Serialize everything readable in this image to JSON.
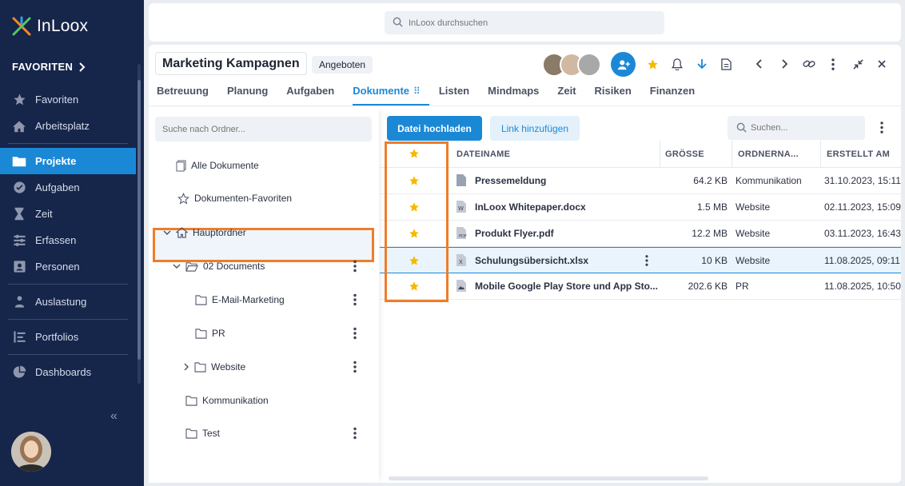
{
  "app": {
    "logo_text": "InLoox"
  },
  "sidebar": {
    "favorites_label": "FAVORITEN",
    "items": [
      {
        "label": "Favoriten"
      },
      {
        "label": "Arbeitsplatz"
      },
      {
        "label": "Projekte"
      },
      {
        "label": "Aufgaben"
      },
      {
        "label": "Zeit"
      },
      {
        "label": "Erfassen"
      },
      {
        "label": "Personen"
      },
      {
        "label": "Auslastung"
      },
      {
        "label": "Portfolios"
      },
      {
        "label": "Dashboards"
      }
    ],
    "collapse_glyph": "«"
  },
  "search": {
    "placeholder": "InLoox durchsuchen"
  },
  "project": {
    "title": "Marketing Kampagnen",
    "status": "Angeboten"
  },
  "tabs": [
    {
      "label": "Betreuung"
    },
    {
      "label": "Planung"
    },
    {
      "label": "Aufgaben"
    },
    {
      "label": "Dokumente"
    },
    {
      "label": "Listen"
    },
    {
      "label": "Mindmaps"
    },
    {
      "label": "Zeit"
    },
    {
      "label": "Risiken"
    },
    {
      "label": "Finanzen"
    }
  ],
  "folders": {
    "search_placeholder": "Suche nach Ordner...",
    "all_documents": "Alle Dokumente",
    "favorites": "Dokumenten-Favoriten",
    "root": "Hauptordner",
    "children": [
      {
        "label": "02 Documents"
      },
      {
        "label": "E-Mail-Marketing"
      },
      {
        "label": "PR"
      },
      {
        "label": "Website"
      },
      {
        "label": "Kommunikation"
      },
      {
        "label": "Test"
      }
    ]
  },
  "toolbar": {
    "upload_label": "Datei hochladen",
    "add_link_label": "Link hinzufügen",
    "search_placeholder": "Suchen..."
  },
  "table": {
    "headers": {
      "name": "DATEINAME",
      "size": "GRÖSSE",
      "folder": "ORDNERNA...",
      "created": "ERSTELLT AM"
    },
    "rows": [
      {
        "name": "Pressemeldung",
        "size": "64.2 KB",
        "folder": "Kommunikation",
        "created": "31.10.2023, 15:11",
        "icon": "file-icon"
      },
      {
        "name": "InLoox Whitepaper.docx",
        "size": "1.5 MB",
        "folder": "Website",
        "created": "02.11.2023, 15:09",
        "icon": "word-file-icon"
      },
      {
        "name": "Produkt Flyer.pdf",
        "size": "12.2 MB",
        "folder": "Website",
        "created": "03.11.2023, 16:43",
        "icon": "pdf-file-icon"
      },
      {
        "name": "Schulungsübersicht.xlsx",
        "size": "10 KB",
        "folder": "Website",
        "created": "11.08.2025, 09:11",
        "icon": "excel-file-icon"
      },
      {
        "name": "Mobile Google Play Store und App Sto...",
        "size": "202.6 KB",
        "folder": "PR",
        "created": "11.08.2025, 10:50",
        "icon": "image-file-icon"
      }
    ]
  },
  "colors": {
    "accent": "#1b88d6",
    "sidebar_bg": "#16254a",
    "highlight": "#ee7d2a",
    "star": "#f5b800"
  }
}
